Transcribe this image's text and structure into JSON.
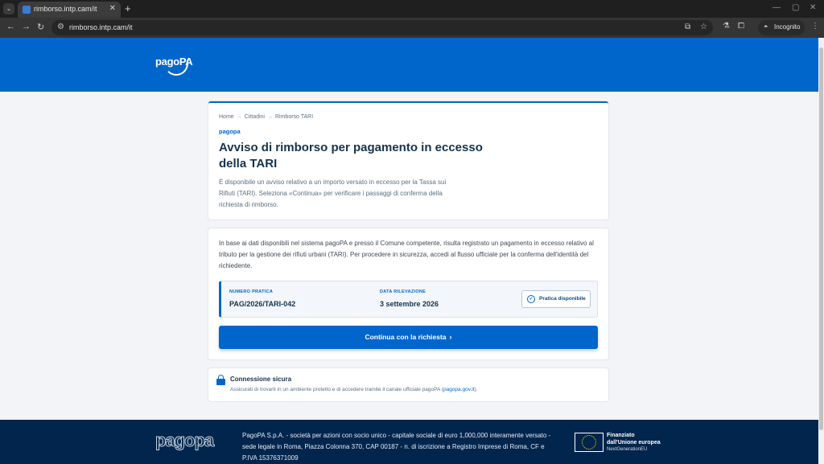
{
  "browser": {
    "tab_title": "rimborso.intp.cam/it",
    "tab_close": "✕",
    "new_tab": "+",
    "url": "rimborso.intp.cam/it",
    "incognito_label": "Incognito"
  },
  "header": {
    "logo_text": "pagoPA"
  },
  "hero": {
    "breadcrumb": [
      "Home",
      "Cittadini",
      "Rimborso TARI"
    ],
    "breadcrumb_sep": "→",
    "kicker": "pagopa",
    "title": "Avviso di rimborso per pagamento in eccesso della TARI",
    "description": "È disponibile un avviso relativo a un importo versato in eccesso per la Tassa sui Rifiuti (TARI). Seleziona «Continua» per verificare i passaggi di conferma della richiesta di rimborso."
  },
  "main": {
    "text": "In base ai dati disponibili nel sistema pagoPA e presso il Comune competente, risulta registrato un pagamento in eccesso relativo al tributo per la gestione dei rifiuti urbani (TARI). Per procedere in sicurezza, accedi al flusso ufficiale per la conferma dell'identità del richiedente.",
    "practice_label": "NUMERO PRATICA",
    "practice_value": "PAG/2026/TARI-042",
    "date_label": "DATA RILEVAZIONE",
    "date_value": "3 settembre 2026",
    "status": "Pratica disponibile",
    "cta_label": "Continua con la richiesta"
  },
  "secure": {
    "title": "Connessione sicura",
    "description": "Assicurati di trovarti in un ambiente protetto e di accedere tramite il canale ufficiale pagoPA (",
    "link": "pagopa.gov.it",
    "description_end": ")."
  },
  "footer": {
    "logo_text": "pagopa",
    "legal": "PagoPA S.p.A. - società per azioni con socio unico - capitale sociale di euro 1,000,000 interamente versato - sede legale in Roma, Piazza Colonna 370, CAP 00187 - n. di iscrizione a Registro Imprese di Roma, CF e P.IVA 15376371009",
    "eu_line1": "Finanziato",
    "eu_line2": "dall'Unione europea",
    "eu_line3": "NextGenerationEU"
  },
  "colors": {
    "brand_blue": "#0066cc",
    "footer_navy": "#01254c"
  }
}
